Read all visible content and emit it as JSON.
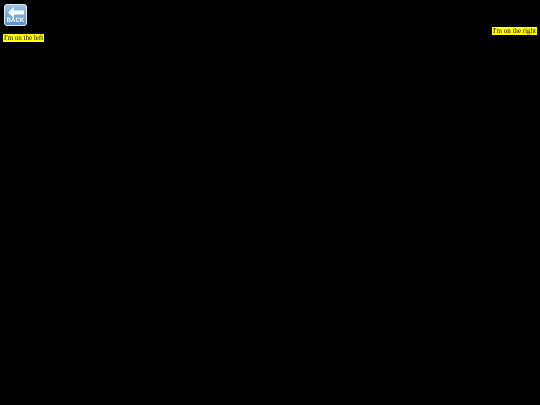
{
  "back_button": {
    "label": "BACK",
    "icon": "left-arrow-icon"
  },
  "notes": {
    "right": "I'm on the right",
    "left": "I'm on the left"
  },
  "colors": {
    "background": "#000000",
    "highlight": "#ffff00",
    "button_top": "#9bc4e6",
    "button_bottom": "#5f93c4"
  }
}
